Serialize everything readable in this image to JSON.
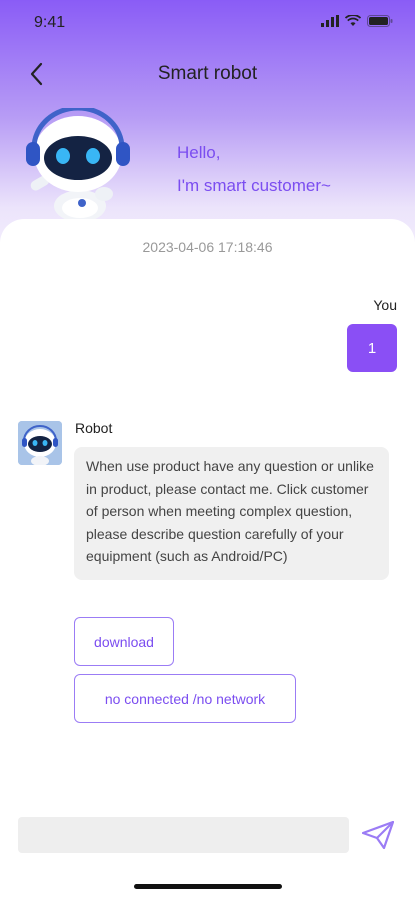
{
  "status_bar": {
    "time": "9:41"
  },
  "nav": {
    "title": "Smart robot"
  },
  "greeting": {
    "line1": "Hello,",
    "line2": "I'm smart customer~"
  },
  "chat": {
    "timestamp": "2023-04-06 17:18:46",
    "user": {
      "label": "You",
      "message": "1"
    },
    "bot": {
      "name": "Robot",
      "message": "When use product have any question or unlike in product,  please contact me. Click customer of person when meeting complex question,  please describe question carefully of your equipment (such as Android/PC)"
    },
    "quick_replies": [
      "download",
      "no connected /no network"
    ]
  },
  "input": {
    "placeholder": ""
  },
  "colors": {
    "accent": "#8a4ff5",
    "accent_text": "#7b4df0"
  }
}
